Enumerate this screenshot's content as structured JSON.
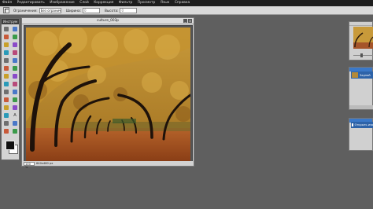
{
  "menu": [
    "Файл",
    "Редактировать",
    "Изображение",
    "Слой",
    "Коррекция",
    "Фильтр",
    "Просмотр",
    "Язык",
    "Справка"
  ],
  "toolbar": {
    "constraint_label": "Ограничение:",
    "constraint_value": "Без ограничений",
    "width_label": "Ширина:",
    "width_value": "0",
    "height_label": "Высота:",
    "height_value": "0"
  },
  "tools_panel": {
    "title": "Инструм",
    "tools": [
      "crop-icon",
      "move-icon",
      "marquee-icon",
      "lasso-icon",
      "magic-wand-icon",
      "pencil-icon",
      "brush-icon",
      "eraser-icon",
      "bucket-icon",
      "gradient-icon",
      "clone-icon",
      "color-replace-icon",
      "drawing-icon",
      "red-eye-icon",
      "spot-heal-icon",
      "bloat-icon",
      "pinch-icon",
      "sponge-icon",
      "dodge-icon",
      "burn-icon",
      "blur-icon",
      "sharpen-icon",
      "smudge-icon",
      "type-icon",
      "hand-icon",
      "zoom-icon",
      "color-picker-icon",
      "eyedropper-icon"
    ]
  },
  "document": {
    "title": "culture_003p",
    "zoom": "100",
    "zoom_unit": "%",
    "size": "640x480 px",
    "min_btn": "_",
    "close_btn": "x"
  },
  "layers_panel": {
    "layer_name": "Задний"
  },
  "history_panel": {
    "entry": "Открыть изо"
  },
  "colors": {
    "foreground": "#111111",
    "background": "#ffffff",
    "selection": "#2e63a8",
    "panel_title": "#3a78c8"
  }
}
